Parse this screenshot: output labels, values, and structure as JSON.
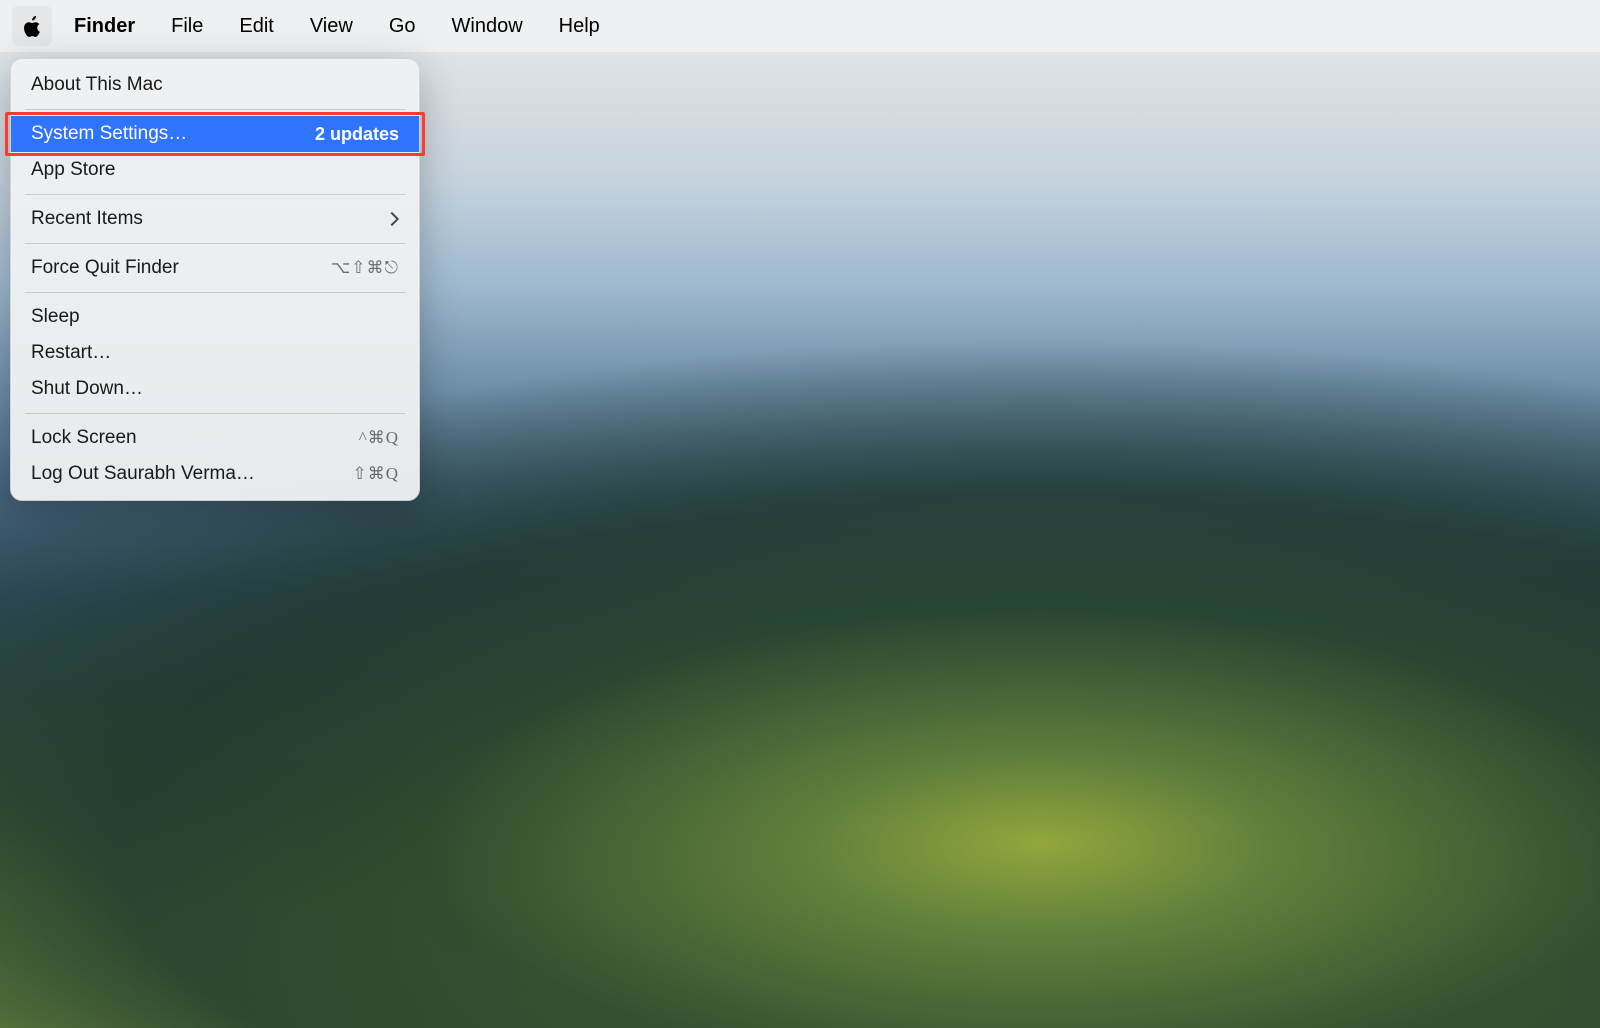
{
  "menubar": {
    "app": "Finder",
    "items": [
      "File",
      "Edit",
      "View",
      "Go",
      "Window",
      "Help"
    ]
  },
  "apple_menu": {
    "about": "About This Mac",
    "system_settings": {
      "label": "System Settings…",
      "badge": "2 updates"
    },
    "app_store": "App Store",
    "recent_items": "Recent Items",
    "force_quit": {
      "label": "Force Quit Finder",
      "shortcut": "⌥⇧⌘⎋"
    },
    "sleep": "Sleep",
    "restart": "Restart…",
    "shutdown": "Shut Down…",
    "lock_screen": {
      "label": "Lock Screen",
      "shortcut": "^⌘Q"
    },
    "logout": {
      "label": "Log Out Saurabh Verma…",
      "shortcut": "⇧⌘Q"
    }
  },
  "annotation": {
    "color": "#ff3b30"
  }
}
